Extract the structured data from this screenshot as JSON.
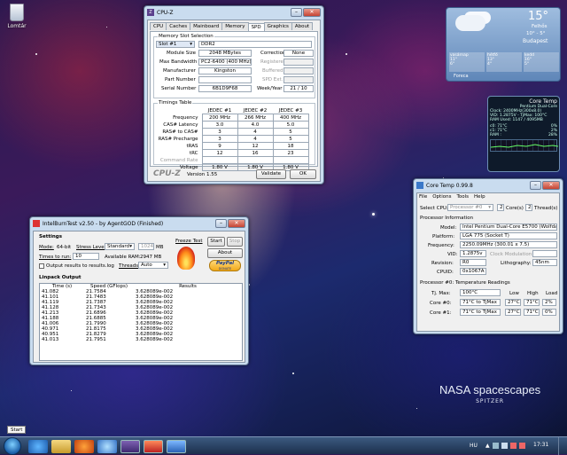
{
  "desktop": {
    "recycle_bin_label": "Lomtár",
    "brand_title": "NASA spacescapes",
    "brand_sub": "SPITZER",
    "start_tooltip": "Start"
  },
  "cpuz": {
    "title": "CPU-Z",
    "tabs": [
      "CPU",
      "Caches",
      "Mainboard",
      "Memory",
      "SPD",
      "Graphics",
      "About"
    ],
    "active_tab": "SPD",
    "slot_group": "Memory Slot Selection",
    "slot_value": "Slot #1",
    "mem_type": "DDR2",
    "labels": {
      "module_size": "Module Size",
      "max_bw": "Max Bandwidth",
      "manufacturer": "Manufacturer",
      "part": "Part Number",
      "serial": "Serial Number",
      "correction": "Correction",
      "registered": "Registered",
      "buffered": "Buffered",
      "spd_ext": "SPD Ext.",
      "week_year": "Week/Year"
    },
    "values": {
      "module_size": "2048 MBytes",
      "max_bw": "PC2-6400 (400 MHz)",
      "manufacturer": "Kingston",
      "part": "",
      "serial": "6B1D9F68",
      "correction": "None",
      "registered": "",
      "buffered": "",
      "spd_ext": "",
      "week_year": "21 / 10"
    },
    "timings_group": "Timings Table",
    "timing_headers": [
      "",
      "JEDEC #1",
      "JEDEC #2",
      "JEDEC #3"
    ],
    "timing_rows": [
      [
        "Frequency",
        "200 MHz",
        "266 MHz",
        "400 MHz"
      ],
      [
        "CAS# Latency",
        "3.0",
        "4.0",
        "5.0"
      ],
      [
        "RAS# to CAS#",
        "3",
        "4",
        "5"
      ],
      [
        "RAS# Precharge",
        "3",
        "4",
        "5"
      ],
      [
        "tRAS",
        "9",
        "12",
        "18"
      ],
      [
        "tRC",
        "12",
        "16",
        "23"
      ],
      [
        "Command Rate",
        "",
        "",
        ""
      ],
      [
        "Voltage",
        "1.80 V",
        "1.80 V",
        "1.80 V"
      ]
    ],
    "brand": "CPU-Z",
    "version": "Version 1.55",
    "validate_btn": "Validate",
    "ok_btn": "OK"
  },
  "ibt": {
    "title": "IntelBurnTest v2.50 - by AgentGOD (Finished)",
    "settings_label": "Settings",
    "mode_label": "Mode:",
    "mode_value": "64-bit",
    "stress_label": "Stress Level:",
    "stress_value": "Standard",
    "stress_mb": "1024",
    "mb": "MB",
    "times_label": "Times to run:",
    "times_value": "10",
    "avail_label": "Available RAM:",
    "avail_value": "2947 MB",
    "output_check": "Output results to results.log",
    "threads_label": "Threads:",
    "threads_value": "Auto",
    "freeze_label": "Freeze Test",
    "start_btn": "Start",
    "stop_btn": "Stop",
    "about_btn": "About",
    "paypal": "PayPal",
    "donate": "DONATE",
    "linpack_label": "Linpack Output",
    "col_time": "Time (s)",
    "col_speed": "Speed (GFlops)",
    "col_results": "Results",
    "rows": [
      [
        "41.082",
        "21.7584",
        "3.628089e-002"
      ],
      [
        "41.101",
        "21.7483",
        "3.628089e-002"
      ],
      [
        "41.119",
        "21.7387",
        "3.628089e-002"
      ],
      [
        "41.128",
        "21.7343",
        "3.628089e-002"
      ],
      [
        "41.213",
        "21.6896",
        "3.628089e-002"
      ],
      [
        "41.188",
        "21.6885",
        "3.628089e-002"
      ],
      [
        "41.006",
        "21.7990",
        "3.628089e-002"
      ],
      [
        "40.971",
        "21.8175",
        "3.628089e-002"
      ],
      [
        "40.951",
        "21.8279",
        "3.628089e-002"
      ],
      [
        "41.013",
        "21.7951",
        "3.628089e-002"
      ]
    ]
  },
  "coretemp": {
    "title": "Core Temp 0.99.8",
    "menu": [
      "File",
      "Options",
      "Tools",
      "Help"
    ],
    "select_cpu_label": "Select CPU:",
    "select_cpu_value": "Processor #0",
    "cores_value": "2",
    "cores_label": "Core(s)",
    "threads_value": "2",
    "threads_label": "Thread(s)",
    "proc_info": "Processor Information",
    "model_label": "Model:",
    "model_value": "Intel Pentium Dual-Core E5700 (Wolfdale-2M)",
    "platform_label": "Platform:",
    "platform_value": "LGA 775 (Socket T)",
    "freq_label": "Frequency:",
    "freq_value": "2250.09MHz (300.01 x 7.5)",
    "vid_label": "VID:",
    "vid_value": "1.2875v",
    "clockmod_label": "Clock Modulation:",
    "clockmod_value": "",
    "revision_label": "Revision:",
    "revision_value": "R0",
    "litho_label": "Lithography:",
    "litho_value": "45nm",
    "cpuid_label": "CPUID:",
    "cpuid_value": "0x1067A",
    "temp_group": "Processor #0: Temperature Readings",
    "tjmax_label": "Tj. Max:",
    "tjmax_value": "100°C",
    "col_low": "Low",
    "col_high": "High",
    "col_load": "Load",
    "cores": [
      {
        "label": "Core #0:",
        "value": "71°C to TjMax",
        "low": "27°C",
        "high": "71°C",
        "load": "2%"
      },
      {
        "label": "Core #1:",
        "value": "71°C to TjMax",
        "low": "27°C",
        "high": "71°C",
        "load": "0%"
      }
    ]
  },
  "weather": {
    "temp": "15°",
    "cond": "Felhős",
    "range": "10° - 5°",
    "city": "Budapest",
    "days": [
      {
        "name": "vasárnap",
        "hi": "11°",
        "lo": "6°"
      },
      {
        "name": "hétfő",
        "hi": "13°",
        "lo": "4°"
      },
      {
        "name": "kedd",
        "hi": "16°",
        "lo": "5°"
      }
    ],
    "source": "Foreca"
  },
  "ctgadget": {
    "title": "Core Temp",
    "cpu": "Pentium Dual-Core",
    "clock": "Clock: 2400MHz(300x8.0)",
    "vid": "VID: 1.2875V - TjMax: 100°C",
    "ram": "RAM Used: 1147 / 4095MB",
    "c0": "c0: 71°C",
    "c0l": "0%",
    "c1": "c1: 71°C",
    "c1l": "2%",
    "ram_label": "RAM :",
    "ram_pct": "28%"
  },
  "tray": {
    "lang": "HU",
    "time": "17:31"
  }
}
